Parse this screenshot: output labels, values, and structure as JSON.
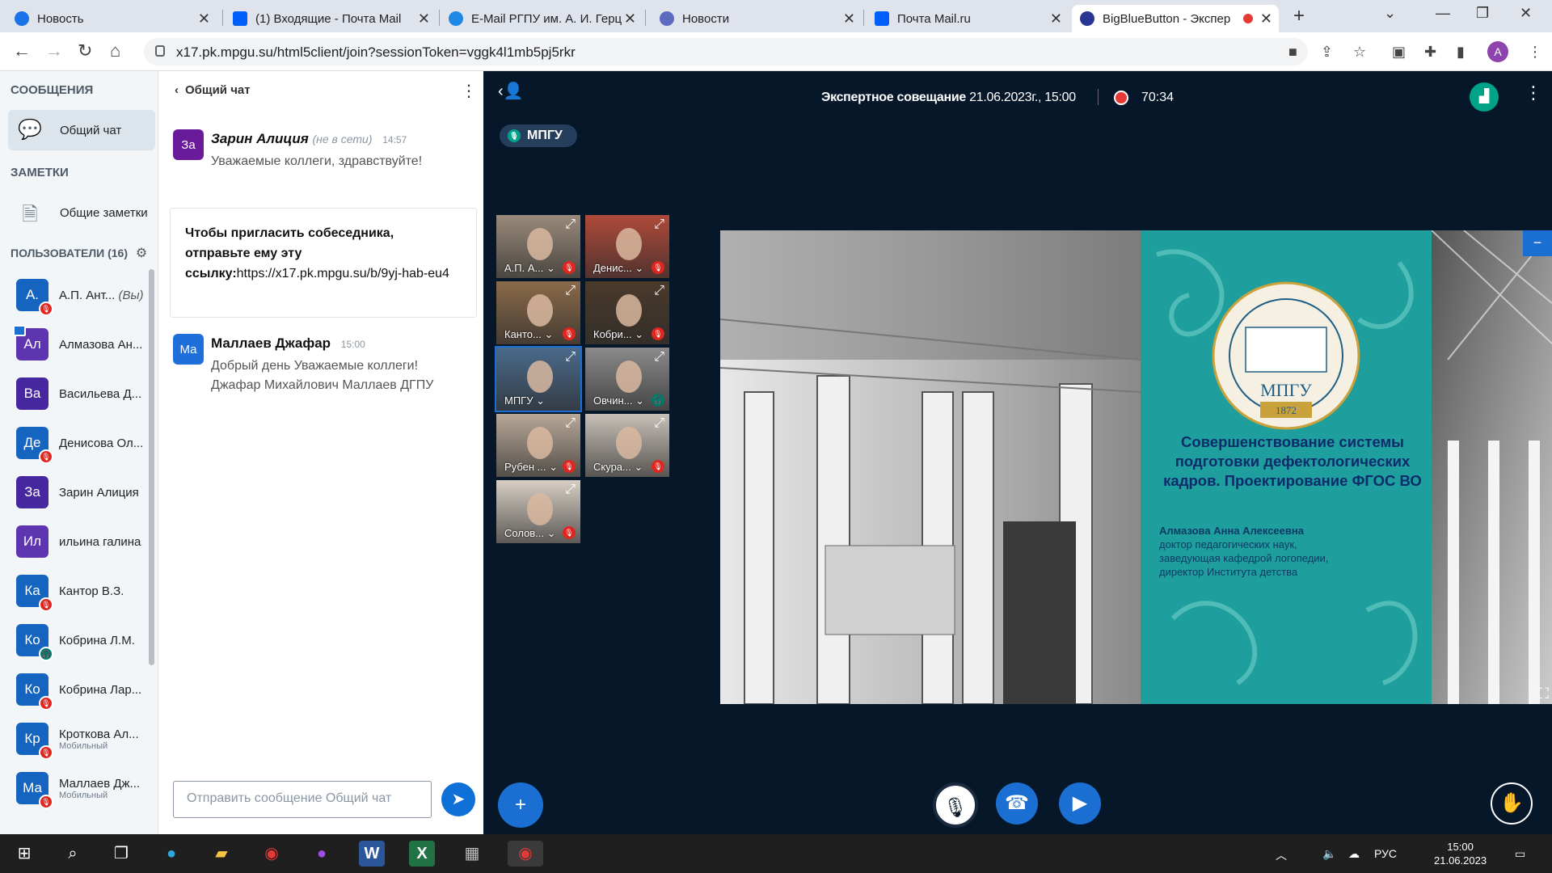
{
  "browser": {
    "tabs": [
      {
        "title": "Новость",
        "color": "#1a73e8"
      },
      {
        "title": "(1) Входящие - Почта Mail",
        "color": "#005ff9"
      },
      {
        "title": "E-Mail РГПУ им. А. И. Герц",
        "color": "#1e88e5"
      },
      {
        "title": "Новости",
        "color": "#5c6bc0"
      },
      {
        "title": "Почта Mail.ru",
        "color": "#005ff9"
      },
      {
        "title": "BigBlueButton - Экспер",
        "color": "#283593"
      }
    ],
    "url": "x17.pk.mpgu.su/html5client/join?sessionToken=vggk4l1mb5pj5rkr",
    "profile_initial": "A"
  },
  "nav": {
    "messages_header": "СООБЩЕНИЯ",
    "public_chat": "Общий чат",
    "notes_header": "ЗАМЕТКИ",
    "shared_notes": "Общие заметки",
    "users_header": "ПОЛЬЗОВАТЕЛИ (16)",
    "users": [
      {
        "initials": "А.",
        "name": "А.П. Ант...",
        "you": "(Вы)",
        "color": "#1565c0",
        "status": "muted"
      },
      {
        "initials": "Ал",
        "name": "Алмазова Ан...",
        "color": "#5e35b1",
        "status": "presenter"
      },
      {
        "initials": "Ва",
        "name": "Васильева Д...",
        "color": "#4527a0",
        "status": ""
      },
      {
        "initials": "Де",
        "name": "Денисова Ол...",
        "color": "#1565c0",
        "status": "muted"
      },
      {
        "initials": "За",
        "name": "Зарин Алиция",
        "color": "#4527a0",
        "status": ""
      },
      {
        "initials": "Ил",
        "name": "ильина галина",
        "color": "#5e35b1",
        "status": ""
      },
      {
        "initials": "Ка",
        "name": "Кантор В.З.",
        "color": "#1565c0",
        "status": "muted"
      },
      {
        "initials": "Ко",
        "name": "Кобрина Л.М.",
        "color": "#1565c0",
        "status": "listen"
      },
      {
        "initials": "Ко",
        "name": "Кобрина Лар...",
        "color": "#1565c0",
        "status": "muted"
      },
      {
        "initials": "Кр",
        "name": "Кроткова Ал...",
        "sub": "Мобильный",
        "color": "#1565c0",
        "status": "muted"
      },
      {
        "initials": "Ма",
        "name": "Маллаев Дж...",
        "sub": "Мобильный",
        "color": "#1565c0",
        "status": "muted"
      }
    ]
  },
  "chat": {
    "title": "Общий чат",
    "messages": [
      {
        "initials": "За",
        "author": "Зарин Алиция",
        "offline": "(не в сети)",
        "time": "14:57",
        "text": "Уважаемые коллеги, здравствуйте!",
        "color": "#6a1b9a"
      },
      {
        "initials": "Ма",
        "author": "Маллаев Джафар",
        "time": "15:00",
        "text1": "Добрый день Уважаемые коллеги!",
        "text2": "Джафар Михайлович Маллаев ДГПУ",
        "color": "#1e6fd9"
      }
    ],
    "invite_text": "Чтобы пригласить собеседника, отправьте ему эту ссылку:",
    "invite_link": "https://x17.pk.mpgu.su/b/9yj-hab-eu4",
    "input_placeholder": "Отправить сообщение Общий чат"
  },
  "meeting": {
    "title": "Экспертное совещание",
    "datetime": "21.06.2023г., 15:00",
    "rec_time": "70:34",
    "group": "МПГУ",
    "tiles": [
      {
        "label": "А.П. А...",
        "status": "muted",
        "bg": "#9a8b7b"
      },
      {
        "label": "Денис...",
        "status": "muted",
        "bg": "#b04a3a"
      },
      {
        "label": "Канто...",
        "status": "muted",
        "bg": "#8a6a4a"
      },
      {
        "label": "Кобри...",
        "status": "muted",
        "bg": "#4a3a2a"
      },
      {
        "label": "МПГУ",
        "status": "",
        "bg": "#4a6a8a"
      },
      {
        "label": "Овчин...",
        "status": "listen",
        "bg": "#8a8a8a"
      },
      {
        "label": "Рубен ...",
        "status": "muted",
        "bg": "#b8a898"
      },
      {
        "label": "Скура...",
        "status": "muted",
        "bg": "#c8c0b8"
      },
      {
        "label": "Солов...",
        "status": "muted",
        "bg": "#d8cfc5"
      }
    ],
    "slide": {
      "seal_text": "МПГУ",
      "seal_year": "1872",
      "seal_ring": "МОСКОВСКИЙ ПЕДАГОГИЧЕСКИЙ ГОСУДАРСТВЕННЫЙ УНИВЕРСИТЕТ",
      "headline": "Совершенствование системы подготовки дефектологических кадров. Проектирование ФГОС ВО",
      "speaker": "Алмазова Анна Алексеевна",
      "role1": "доктор педагогических наук,",
      "role2": "заведующая кафедрой логопедии,",
      "role3": "директор Института детства"
    }
  },
  "taskbar": {
    "lang": "РУС",
    "time": "15:00",
    "date": "21.06.2023"
  }
}
